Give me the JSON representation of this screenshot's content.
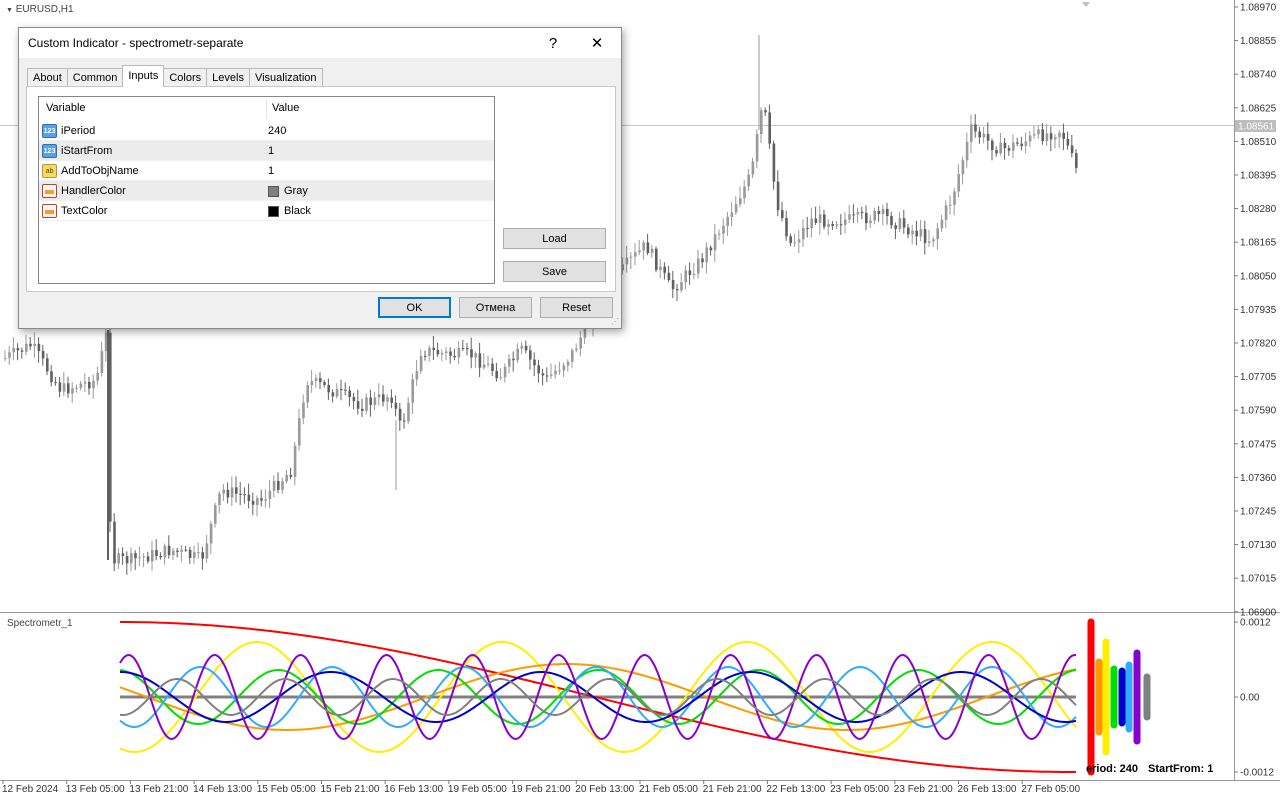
{
  "chart": {
    "symbol_label": "EURUSD,H1",
    "subwindow_label": "Spectrometr_1",
    "current_price": "1.08561",
    "price_ticks": [
      "1.08970",
      "1.08855",
      "1.08740",
      "1.08625",
      "1.08510",
      "1.08395",
      "1.08280",
      "1.08165",
      "1.08050",
      "1.07935",
      "1.07820",
      "1.07705",
      "1.07590",
      "1.07475",
      "1.07360",
      "1.07245",
      "1.07130",
      "1.07015",
      "1.06900"
    ],
    "sub_ticks": [
      "0.0012",
      "0.00",
      "-0.0012"
    ],
    "time_ticks": [
      "12 Feb 2024",
      "13 Feb 05:00",
      "13 Feb 21:00",
      "14 Feb 13:00",
      "15 Feb 05:00",
      "15 Feb 21:00",
      "16 Feb 13:00",
      "19 Feb 05:00",
      "19 Feb 21:00",
      "20 Feb 13:00",
      "21 Feb 05:00",
      "21 Feb 21:00",
      "22 Feb 13:00",
      "23 Feb 05:00",
      "23 Feb 21:00",
      "26 Feb 13:00",
      "27 Feb 05:00"
    ],
    "overlay_text": {
      "period": "eriod: 240",
      "start_from": "StartFrom: 1"
    },
    "colors": {
      "candle": "#9a9a9a",
      "candle_dark": "#606060",
      "grid": "#e6e6e6"
    },
    "wave_colors": [
      "#ff0000",
      "#ffee00",
      "#ff9900",
      "#00dd00",
      "#33aaff",
      "#0000cc",
      "#8800cc",
      "#808080"
    ]
  },
  "dialog": {
    "title": "Custom Indicator - spectrometr-separate",
    "help": "?",
    "close": "✕",
    "tabs": [
      "About",
      "Common",
      "Inputs",
      "Colors",
      "Levels",
      "Visualization"
    ],
    "active_tab": "Inputs",
    "headers": {
      "variable": "Variable",
      "value": "Value"
    },
    "rows": [
      {
        "icon": "123",
        "name": "iPeriod",
        "value": "240"
      },
      {
        "icon": "123",
        "name": "iStartFrom",
        "value": "1"
      },
      {
        "icon": "ab",
        "name": "AddToObjName",
        "value": "1"
      },
      {
        "icon": "",
        "name": "HandlerColor",
        "value": "Gray",
        "swatch": "#808080"
      },
      {
        "icon": "",
        "name": "TextColor",
        "value": "Black",
        "swatch": "#000000"
      }
    ],
    "buttons": {
      "load": "Load",
      "save": "Save",
      "ok": "OK",
      "cancel": "Отмена",
      "reset": "Reset"
    }
  }
}
